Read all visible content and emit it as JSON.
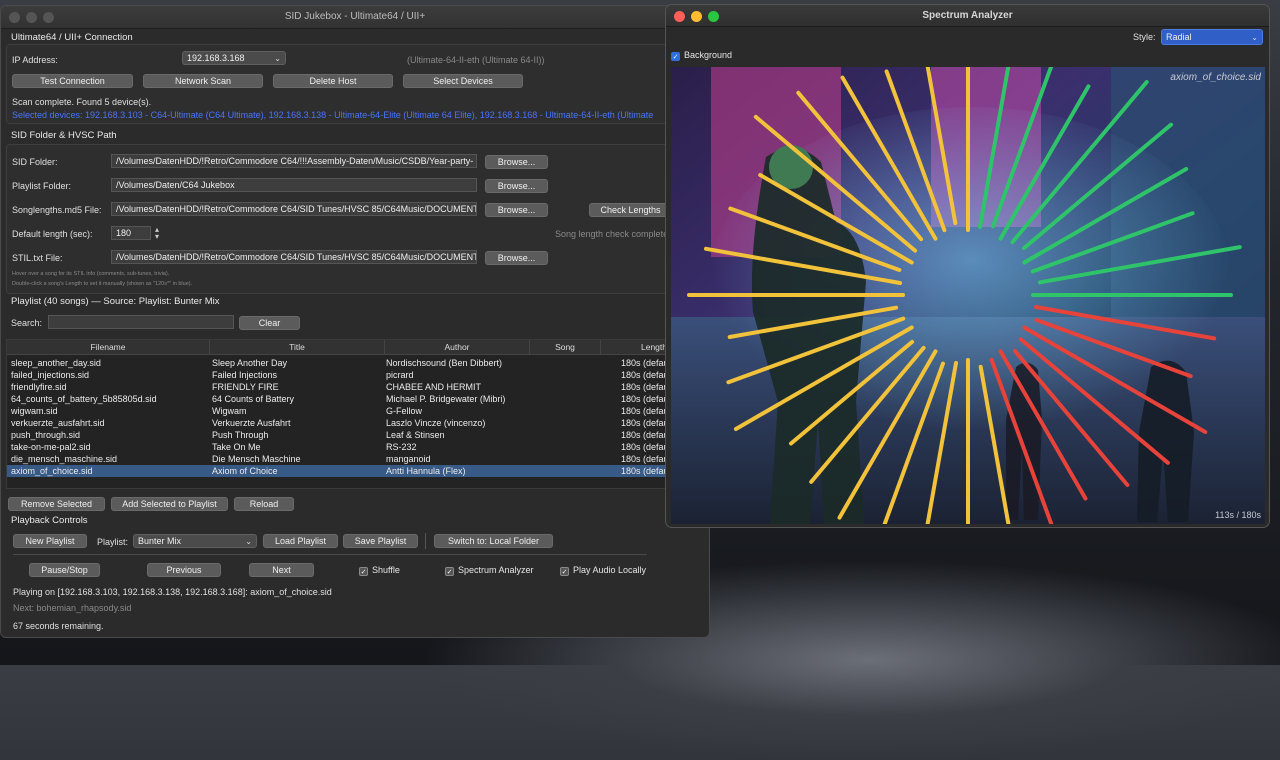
{
  "main_window": {
    "title": "SID Jukebox - Ultimate64 / UII+",
    "connection": {
      "section_title": "Ultimate64 / UII+ Connection",
      "ip_label": "IP Address:",
      "ip_value": "192.168.3.168",
      "device_info": "(Ultimate-64-II-eth (Ultimate 64-II))",
      "buttons": [
        "Test Connection",
        "Network Scan",
        "Delete Host",
        "Select Devices"
      ],
      "scan_status": "Scan complete. Found 5 device(s).",
      "selected_devices": "Selected devices: 192.168.3.103 - C64-Ultimate (C64 Ultimate), 192.168.3.138 - Ultimate-64-Elite (Ultimate 64 Elite), 192.168.3.168 - Ultimate-64-II-eth (Ultimate"
    },
    "folders": {
      "section_title": "SID Folder & HVSC Path",
      "sid_folder_label": "SID Folder:",
      "sid_folder_value": "/Volumes/DatenHDD/!Retro/Commodore C64/!!!Assembly-Daten/Music/CSDB/Year-party-",
      "playlist_folder_label": "Playlist Folder:",
      "playlist_folder_value": "/Volumes/Daten/C64 Jukebox",
      "songlengths_label": "Songlengths.md5 File:",
      "songlengths_value": "/Volumes/DatenHDD/!Retro/Commodore C64/SID Tunes/HVSC 85/C64Music/DOCUMENT",
      "check_lengths_label": "Check Lengths",
      "default_length_label": "Default length (sec):",
      "default_length_value": "180",
      "length_check_status": "Song length check complete",
      "stil_label": "STIL.txt File:",
      "stil_value": "/Volumes/DatenHDD/!Retro/Commodore C64/SID Tunes/HVSC 85/C64Music/DOCUMENT",
      "browse_label": "Browse...",
      "hint_1": "Hover over a song for its STIL info (comments, sub-tunes, trivia).",
      "hint_2": "Double-click a song's Length to set it manually (shown as \"120s*\" in blue)."
    },
    "playlist": {
      "section_title": "Playlist (40 songs) — Source: Playlist: Bunter Mix",
      "search_label": "Search:",
      "search_value": "",
      "clear_label": "Clear",
      "columns": [
        "Filename",
        "Title",
        "Author",
        "Song",
        "Length"
      ],
      "rows": [
        [
          "sleep_another_day.sid",
          "Sleep Another Day",
          "Nordischsound (Ben Dibbert)",
          "",
          "180s (defau"
        ],
        [
          "failed_injections.sid",
          "Failed Injections",
          "picrard",
          "",
          "180s (defau"
        ],
        [
          "friendlyfire.sid",
          "FRIENDLY FIRE",
          "CHABEE AND HERMIT",
          "",
          "180s (defau"
        ],
        [
          "64_counts_of_battery_5b85805d.sid",
          "64 Counts of Battery",
          "Michael P. Bridgewater (Mibri)",
          "",
          "180s (defau"
        ],
        [
          "wigwam.sid",
          "Wigwam",
          "G-Fellow",
          "",
          "180s (defau"
        ],
        [
          "verkuerzte_ausfahrt.sid",
          "Verkuerzte Ausfahrt",
          "Laszlo Vincze (vincenzo)",
          "",
          "180s (defau"
        ],
        [
          "push_through.sid",
          "Push Through",
          "Leaf & Stinsen",
          "",
          "180s (defau"
        ],
        [
          "take-on-me-pal2.sid",
          "Take On Me",
          "RS-232",
          "",
          "180s (defau"
        ],
        [
          "die_mensch_maschine.sid",
          "Die Mensch Maschine",
          "manganoid",
          "",
          "180s (defau"
        ],
        [
          "axiom_of_choice.sid",
          "Axiom of Choice",
          "Antti Hannula (Flex)",
          "",
          "180s (defau"
        ]
      ],
      "selected_row": 9,
      "actions": [
        "Remove Selected",
        "Add Selected to Playlist",
        "Reload"
      ]
    },
    "playback": {
      "section_title": "Playback Controls",
      "new_playlist_label": "New Playlist",
      "playlist_label": "Playlist:",
      "playlist_value": "Bunter Mix",
      "load_playlist_label": "Load Playlist",
      "save_playlist_label": "Save Playlist",
      "switch_label": "Switch to: Local Folder",
      "pause_label": "Pause/Stop",
      "previous_label": "Previous",
      "next_label": "Next",
      "shuffle_label": "Shuffle",
      "spectrum_label": "Spectrum Analyzer",
      "play_local_label": "Play Audio Locally",
      "now_playing": "Playing on [192.168.3.103, 192.168.3.138, 192.168.3.168]: axiom_of_choice.sid",
      "next_song": "Next: bohemian_rhapsody.sid",
      "remaining": "67 seconds remaining."
    }
  },
  "spectrum_window": {
    "title": "Spectrum Analyzer",
    "style_label": "Style:",
    "style_value": "Radial",
    "background_label": "Background",
    "background_checked": true,
    "song_label": "axiom_of_choice.sid",
    "time_label": "113s / 180s",
    "ray_colors": {
      "yellow": "#f2c23a",
      "green": "#2fc46a",
      "red": "#e8433a"
    }
  }
}
